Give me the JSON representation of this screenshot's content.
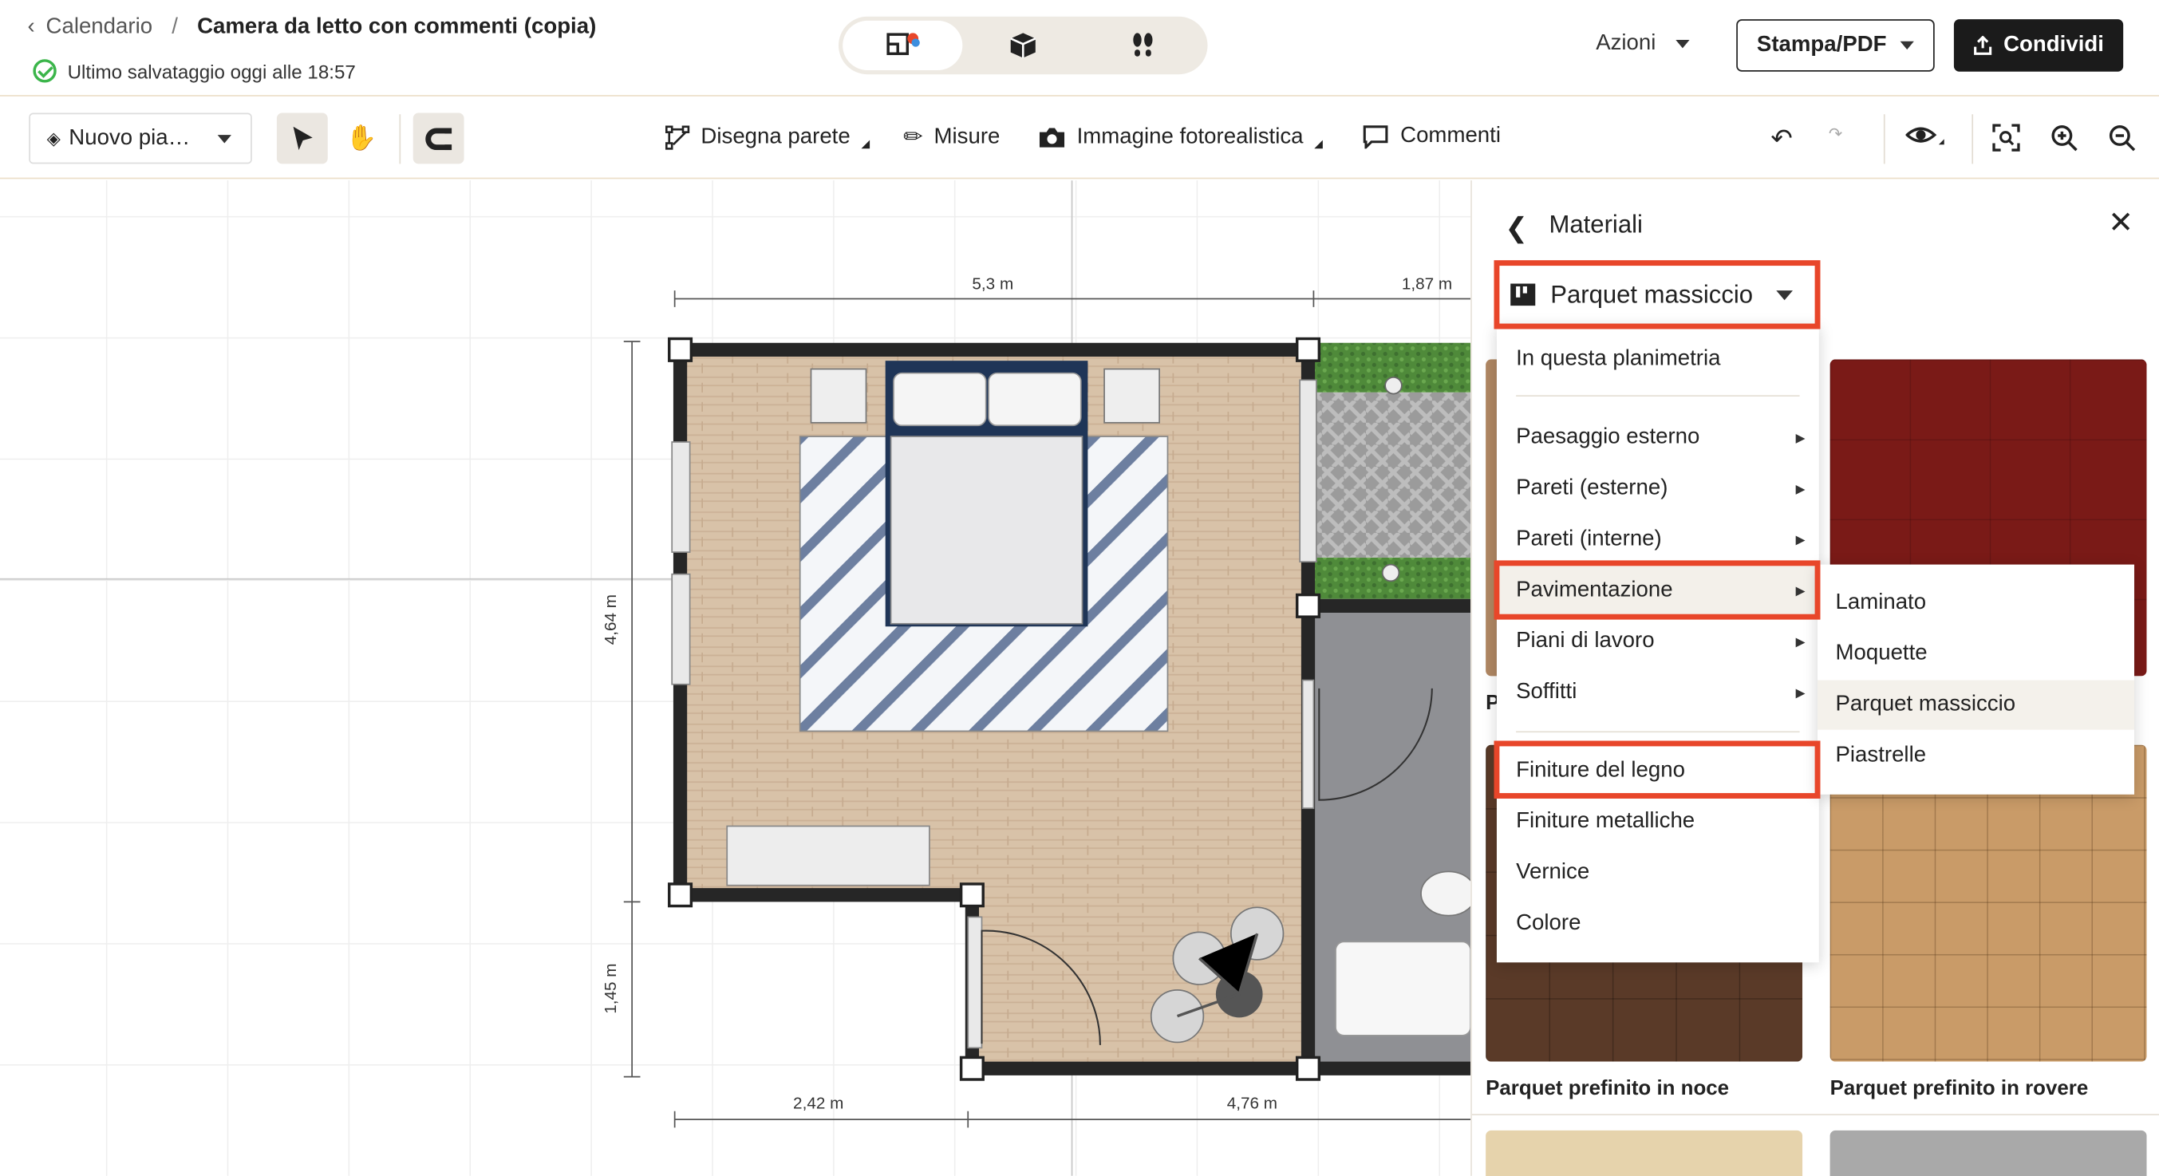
{
  "header": {
    "back_label": "Calendario",
    "separator": "/",
    "title": "Camera da letto con commenti (copia)",
    "saved_text": "Ultimo salvataggio oggi alle 18:57",
    "actions_label": "Azioni",
    "print_label": "Stampa/PDF",
    "share_label": "Condividi"
  },
  "view_switch": {
    "items": [
      "2d-3d-view",
      "3d-view",
      "walk-view"
    ],
    "active": "2d-3d-view"
  },
  "toolbar": {
    "layer_label": "Nuovo pia…",
    "draw_wall_label": "Disegna parete",
    "measures_label": "Misure",
    "photo_label": "Immagine fotorealistica",
    "comments_label": "Commenti"
  },
  "canvas": {
    "dimensions": {
      "top_left": "5,3 m",
      "top_right": "1,87 m",
      "left_upper": "4,64 m",
      "left_lower": "1,45 m",
      "bottom_left": "2,42 m",
      "bottom_right": "4,76 m"
    }
  },
  "panel": {
    "title": "Materiali",
    "selected_category": "Parquet massiccio",
    "tiles": [
      {
        "label": "Parquet prefinito in noce",
        "color": "#5a3a28"
      },
      {
        "label": "Parquet prefinito in rovere",
        "color": "#c99b68"
      }
    ],
    "partial_tile_label": "P"
  },
  "menu": {
    "items": [
      {
        "label": "In questa planimetria",
        "submenu": false
      },
      {
        "label": "Paesaggio esterno",
        "submenu": true
      },
      {
        "label": "Pareti (esterne)",
        "submenu": true
      },
      {
        "label": "Pareti (interne)",
        "submenu": true
      },
      {
        "label": "Pavimentazione",
        "submenu": true
      },
      {
        "label": "Piani di lavoro",
        "submenu": true
      },
      {
        "label": "Soffitti",
        "submenu": true
      },
      {
        "label": "Finiture del legno",
        "submenu": false
      },
      {
        "label": "Finiture metalliche",
        "submenu": false
      },
      {
        "label": "Vernice",
        "submenu": false
      },
      {
        "label": "Colore",
        "submenu": false
      }
    ]
  },
  "submenu": {
    "items": [
      "Laminato",
      "Moquette",
      "Parquet massiccio",
      "Piastrelle"
    ],
    "selected": "Parquet massiccio"
  },
  "colors": {
    "highlight": "#e8462a",
    "accent_dark": "#1b1b1b",
    "saved_ok": "#3bb54a"
  }
}
